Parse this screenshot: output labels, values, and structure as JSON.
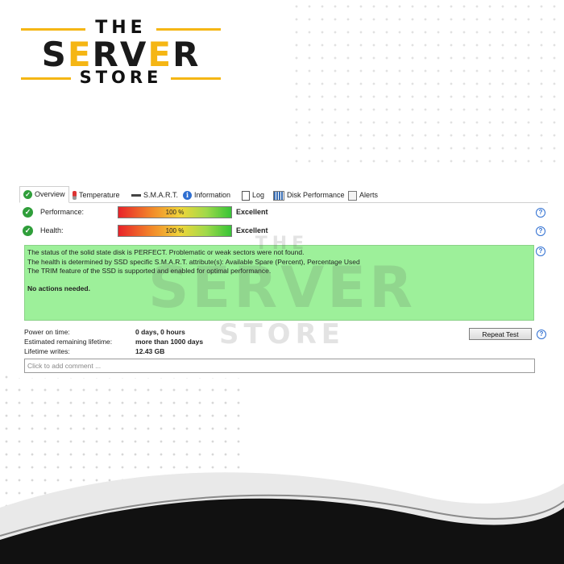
{
  "brand": {
    "the": "THE",
    "server": "SERVER",
    "store": "STORE",
    "accent_color": "#f5b614"
  },
  "watermark": {
    "the": "THE",
    "server": "SERVER",
    "store": "STORE"
  },
  "tabs": [
    {
      "label": "Overview",
      "icon": "check-circle-icon",
      "active": true
    },
    {
      "label": "Temperature",
      "icon": "thermometer-icon"
    },
    {
      "label": "S.M.A.R.T.",
      "icon": "smart-bar-icon"
    },
    {
      "label": "Information",
      "icon": "info-icon"
    },
    {
      "label": "Log",
      "icon": "document-icon"
    },
    {
      "label": "Disk Performance",
      "icon": "bar-chart-icon"
    },
    {
      "label": "Alerts",
      "icon": "alerts-icon"
    }
  ],
  "performance": {
    "label": "Performance:",
    "percent_text": "100 %",
    "value": 100,
    "rating": "Excellent"
  },
  "health": {
    "label": "Health:",
    "percent_text": "100 %",
    "value": 100,
    "rating": "Excellent"
  },
  "status": {
    "line1": "The status of the solid state disk is PERFECT. Problematic or weak sectors were not found.",
    "line2": "The health is determined by SSD specific S.M.A.R.T. attribute(s):  Available Spare (Percent), Percentage Used",
    "line3": "The TRIM feature of the SSD is supported and enabled for optimal performance.",
    "actions": "No actions needed.",
    "background": "#9df09a"
  },
  "stats": [
    {
      "label": "Power on time:",
      "value": "0 days, 0 hours"
    },
    {
      "label": "Estimated remaining lifetime:",
      "value": "more than 1000 days"
    },
    {
      "label": "Lifetime writes:",
      "value": "12.43 GB"
    }
  ],
  "repeat_button": "Repeat Test",
  "comment_placeholder": "Click to add comment ...",
  "help_glyph": "?"
}
